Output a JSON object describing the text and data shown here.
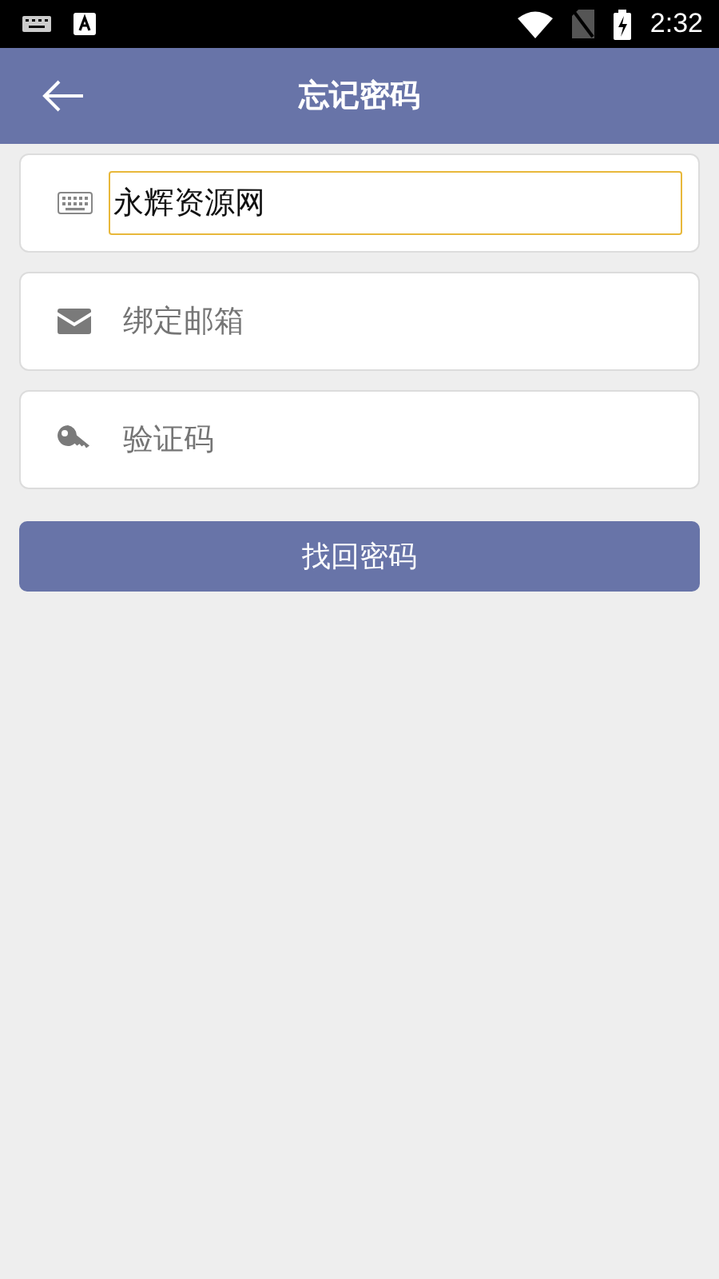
{
  "status_bar": {
    "time": "2:32"
  },
  "header": {
    "title": "忘记密码"
  },
  "fields": [
    {
      "kind": "keyboard",
      "value": "永辉资源网",
      "focused": true
    },
    {
      "kind": "mail",
      "placeholder": "绑定邮箱",
      "focused": false
    },
    {
      "kind": "key",
      "placeholder": "验证码",
      "focused": false
    }
  ],
  "submit_button": {
    "label": "找回密码"
  }
}
